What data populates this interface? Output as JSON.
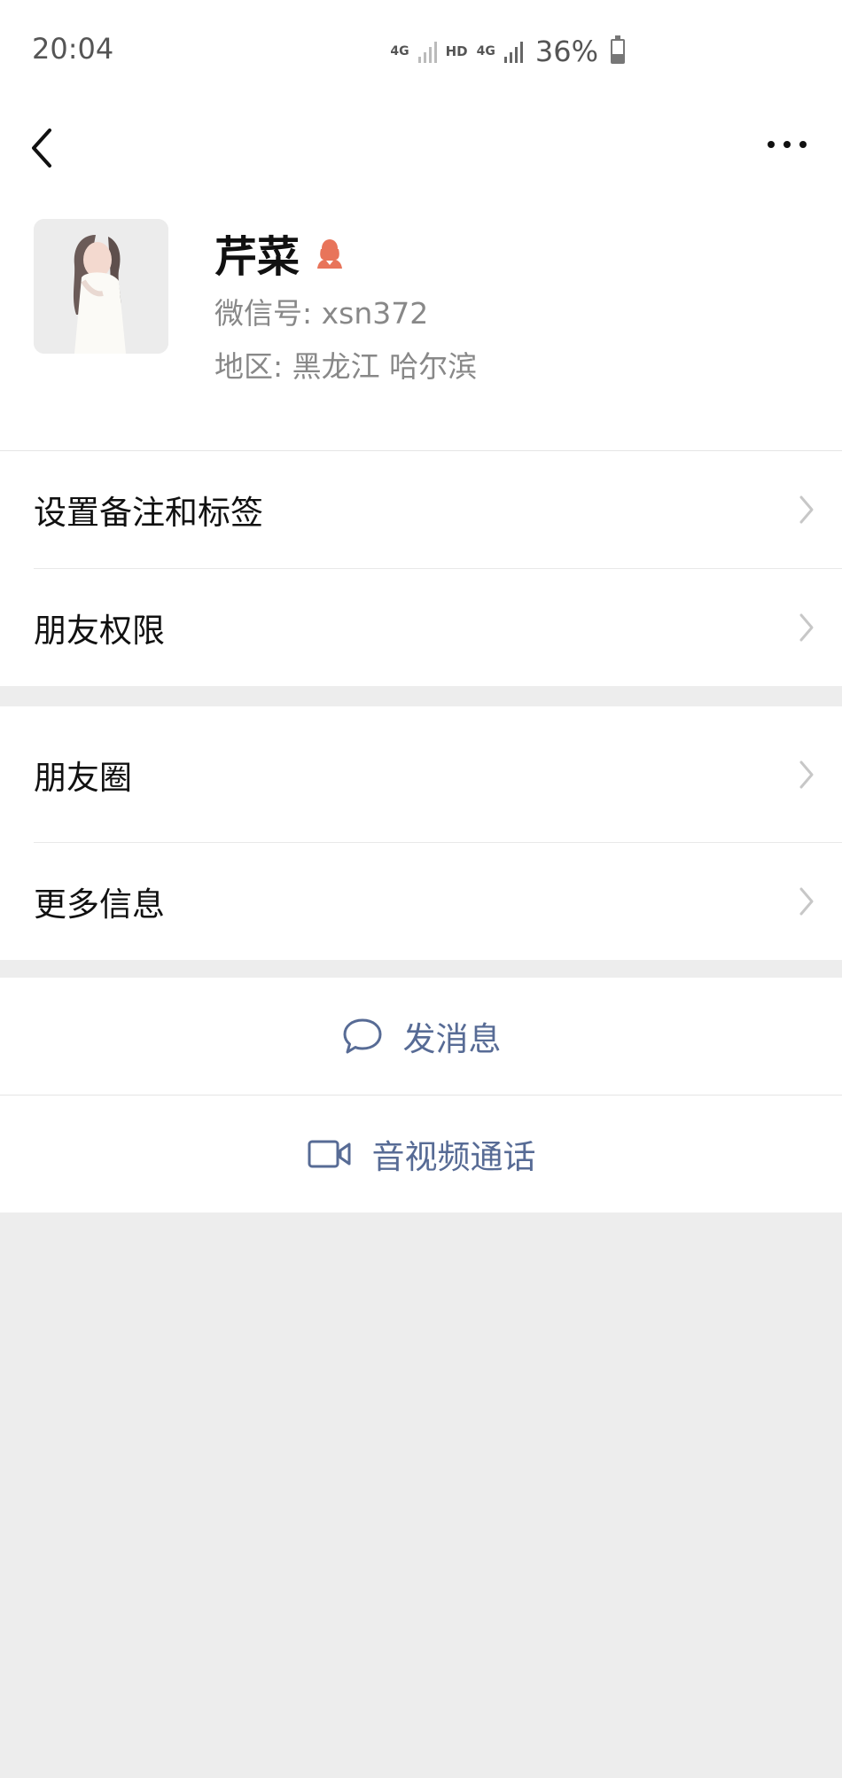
{
  "status_bar": {
    "time": "20:04",
    "network1": "4G",
    "hd": "HD",
    "network2": "4G",
    "battery": "36%"
  },
  "nav": {
    "back_icon": "chevron-left-icon",
    "more_icon": "ellipsis-icon"
  },
  "profile": {
    "name": "芹菜",
    "gender_icon": "female-icon",
    "gender_color": "#e8745a",
    "wechat_id": "微信号: xsn372",
    "region": "地区: 黑龙江  哈尔滨"
  },
  "menu_group_1": [
    {
      "label": "设置备注和标签"
    },
    {
      "label": "朋友权限"
    }
  ],
  "menu_group_2": [
    {
      "label": "朋友圈"
    },
    {
      "label": "更多信息"
    }
  ],
  "actions": {
    "send_message": "发消息",
    "video_call": "音视频通话",
    "link_color": "#576b95"
  }
}
